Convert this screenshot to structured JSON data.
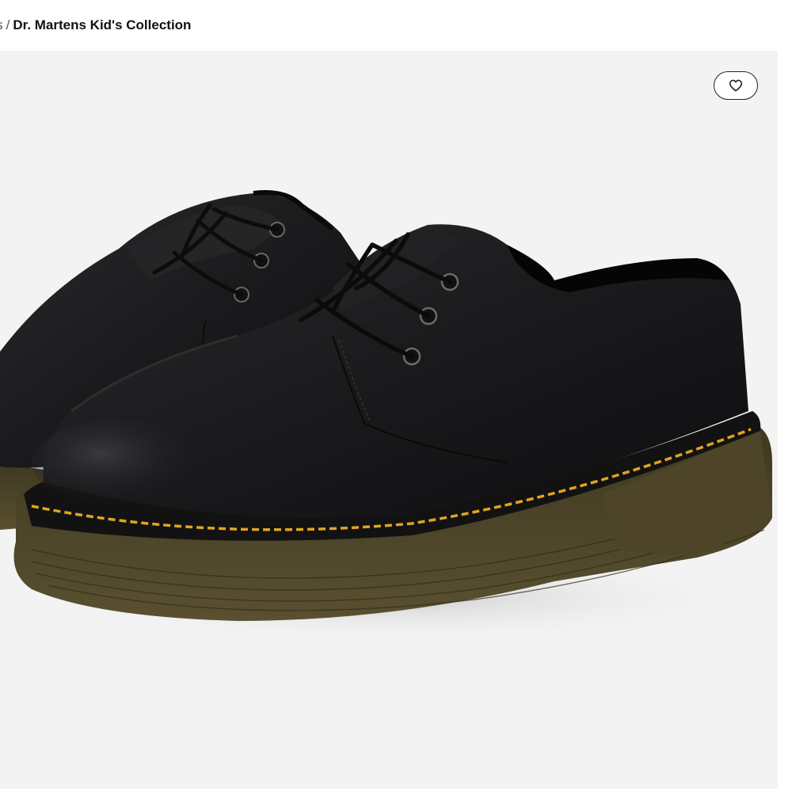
{
  "breadcrumb": {
    "previous": "rds",
    "separator": "/",
    "current": "Dr. Martens Kid's Collection"
  },
  "product_image": {
    "alt": "Black leather lace-up oxford shoes with yellow welt stitching",
    "colors": {
      "panel_bg": "#f3f3f4",
      "leather": "#1c1c1e",
      "sole": "#4a4226",
      "stitch": "#e0a421"
    }
  },
  "favorite_button": {
    "icon": "heart-icon"
  }
}
